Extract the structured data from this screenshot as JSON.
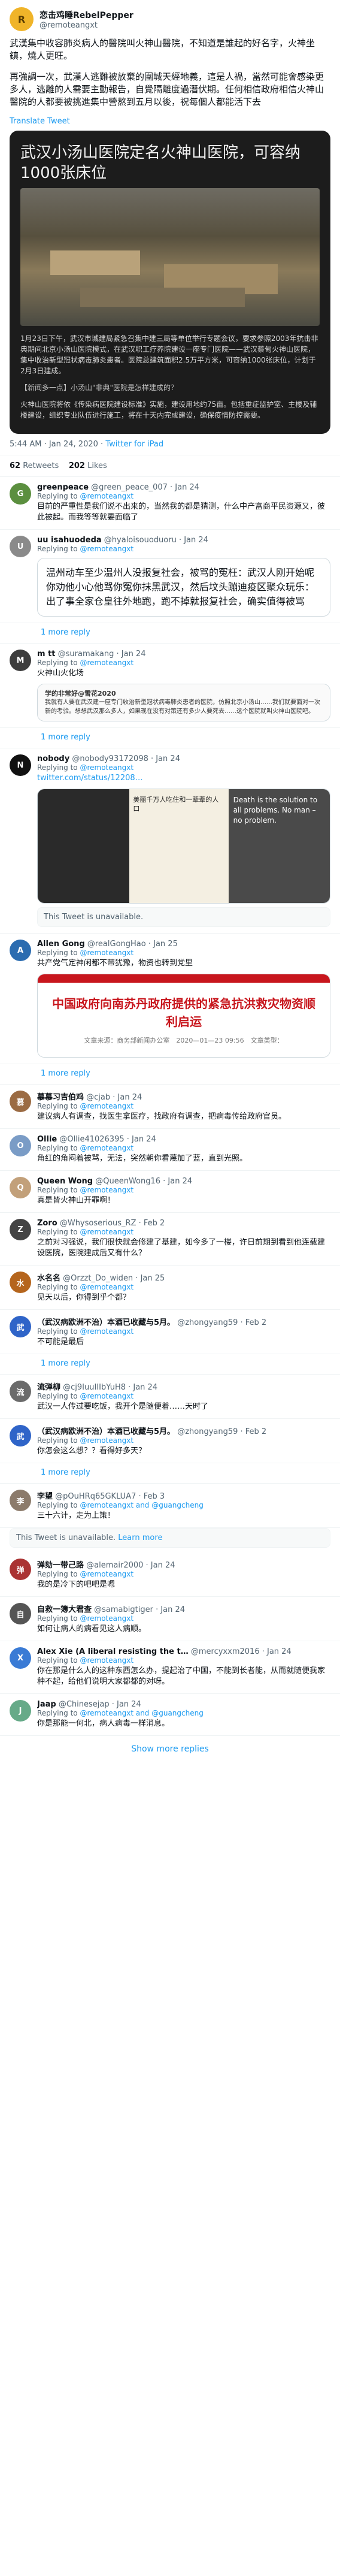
{
  "main": {
    "author_name": "恋击鸡睡RebelPepper",
    "author_handle": "@remoteangxt",
    "paragraphs": [
      "武漢集中收容肺炎病人的醫院叫火神山醫院，不知道是誰起的好名字，火神坐鎮，燒人更旺。",
      "再強調一次，武漢人逃難被放棄的圍城天經地義，這是人禍，當然可能會感染更多人，逃離的人需要主動報告，自覺隔離度過潛伏期。任何相信政府相信火神山醫院的人都要被挑進集中營熬到五月以後，祝每個人都能活下去"
    ],
    "translate": "Translate Tweet",
    "image": {
      "headline": "武汉小汤山医院定名火神山医院，可容纳1000张床位",
      "body_p1": "1月23日下午，武汉市城建局紧急召集中建三局等单位举行专题会议，要求参照2003年抗击非典期间北京小汤山医院模式，在武汉职工疗养院建设一座专门医院——武汉蔡甸火神山医院，集中收治新型冠状病毒肺炎患者。医院总建筑面积2.5万平方米，可容纳1000张床位，计划于2月3日建成。",
      "body_p2": "【新闻多一点】小汤山\"非典\"医院是怎样建成的？",
      "body_p3": "火神山医院将依《传染病医院建设标准》实施，建设用地约75亩。包括重症监护室、主楼及辅楼建设，组织专业队伍进行施工，将在十天内完成建设，确保疫情防控需要。"
    },
    "time": "5:44 AM · Jan 24, 2020 ·",
    "source": "Twitter for iPad",
    "retweets": "62",
    "retweets_label": "Retweets",
    "likes": "202",
    "likes_label": "Likes"
  },
  "replies": [
    {
      "avatar": "G",
      "name": "greenpeace",
      "handle": "@green_peace_007 · Jan 24",
      "to": "@remoteangxt",
      "text": "目前的严重性是我们说不出来的，当然我的都是猜测，什么中产富商平民资源又，彼此被起。而我等等就要面临了"
    },
    {
      "avatar": "U",
      "name": "uu isahuodeda",
      "handle": "@hyaloisouoduoru · Jan 24",
      "to": "@remoteangxt",
      "quote": "温州动车至少温州人没报复社会，被骂的冤枉：武汉人刚开始呢你劝他小心他骂你冤你抹黑武汉，然后坟头蹦迪疫区聚众玩乐：出了事全家仓皇往外地跑，跑不掉就报复社会，确实值得被骂",
      "more": "1 more reply"
    },
    {
      "avatar": "M",
      "name": "m tt",
      "handle": "@suramakang · Jan 24",
      "to": "@remoteangxt",
      "text": "火神山火化场",
      "weibo_name": "学的非常好@雪花2020",
      "weibo_text": "我就有人要在武汉建一座专门收治新型冠状病毒肺炎患者的医院，仿照北京小汤山……我们就要面对一次新的考验。想想武汉那么多人，如果现在没有对策还有多少人要死去……这个医院就叫火神山医院吧。",
      "more": "1 more reply"
    },
    {
      "avatar": "N",
      "name": "nobody",
      "handle": "@nobody93172098 · Jan 24",
      "to": "@remoteangxt",
      "text": "twitter.com/status/12208…",
      "caption1": "美丽千万人吃住和一辈辈的人口",
      "caption2": "Death is the solution to all problems. No man – no problem.",
      "unavailable": "This Tweet is unavailable."
    },
    {
      "avatar": "A",
      "name": "Allen Gong",
      "handle": "@realGongHao · Jan 25",
      "to": "@remoteangxt",
      "text": "共产党气定神闲都不带犹豫，物资也转到党里",
      "card_title": "中国政府向南苏丹政府提供的紧急抗洪救灾物资顺利启运",
      "card_source": "文章来源：商务部新闻办公室　2020—01—23 09:56　文章类型：",
      "more": "1 more reply"
    },
    {
      "avatar": "慕",
      "name": "慕慕习吉伯鸡",
      "handle": "@cjab · Jan 24",
      "to": "@remoteangxt",
      "text": "建议病人有调查，找医生拿医疗，找政府有调查，把病毒传给政府官员。"
    },
    {
      "avatar": "O",
      "name": "Ollie",
      "handle": "@Ollie41026395 · Jan 24",
      "to": "@remoteangxt",
      "text": "角红的角闷着被骂，无法，突然朝你看蔑加了蓝，直到光照。"
    },
    {
      "avatar": "Q",
      "name": "Queen Wong",
      "handle": "@QueenWong16 · Jan 24",
      "to": "@remoteangxt",
      "text": "真是皆火神山开罪啊！"
    },
    {
      "avatar": "Z",
      "name": "Zoro",
      "handle": "@Whysoserious_RZ · Feb 2",
      "to": "@remoteangxt",
      "text": "之前对习强说，我们很快就会修建了基建，如今多了一楼，许日前期到看到他连载建设医院，医院建成后又有什么？"
    },
    {
      "avatar": "水",
      "name": "水名名",
      "handle": "@Orzzt_Do_widen · Jan 25",
      "to": "@remoteangxt",
      "text": "见天以后，你得到乎个都？"
    },
    {
      "avatar": "武",
      "name": "（武汉病欧洲不治）本酒已收藏与5月。",
      "handle": "@zhongyang59 · Feb 2",
      "to": "@remoteangxt",
      "text": "不可能是最后",
      "more": "1 more reply"
    },
    {
      "avatar": "流",
      "name": "流弹柳",
      "handle": "@cj9IuuIIIbYuH8 · Jan 24",
      "to": "@remoteangxt",
      "text": "武汉一人传过要吃饭，我开个是随便着……天时了"
    },
    {
      "avatar": "武",
      "name": "（武汉病欧洲不治）本酒已收藏与5月。",
      "handle": "@zhongyang59 · Feb 2",
      "to": "@remoteangxt",
      "text": "你怎会这么想？？看得好多天？",
      "more": "1 more reply"
    },
    {
      "avatar": "李",
      "name": "李望",
      "handle": "@pOuHRq65GKLUA7 · Feb 3",
      "to": "@remoteangxt and @guangcheng",
      "text": "三十六计，走为上策！",
      "unavailable": "This Tweet is unavailable. ",
      "unavailable_link": "Learn more"
    },
    {
      "avatar": "弹",
      "name": "弹劾一带己路",
      "handle": "@alemair2000 · Jan 24",
      "to": "@remoteangxt",
      "text": "我的是冷下的吧吧是嗯"
    },
    {
      "avatar": "自",
      "name": "自救一簿大君查",
      "handle": "@samabigtiger · Jan 24",
      "to": "@remoteangxt",
      "text": "如何让病人的病看见这人病顺。"
    },
    {
      "avatar": "X",
      "name": "Alex Xie (A liberal resisting the t…",
      "handle": "@mercyxxm2016 · Jan 24",
      "to": "@remoteangxt",
      "text": "你在那是什么人的这种东西怎么办，提起治了中国，不能到长者能，从而就随便我家种不起，给他们说明大家都都的对呀。"
    },
    {
      "avatar": "J",
      "name": "Jaap",
      "handle": "@Chinesejap · Jan 24",
      "to": "@remoteangxt and @guangcheng",
      "text": "你是那能一何北，病人病毒一样消息。"
    }
  ],
  "show_more": "Show more replies"
}
